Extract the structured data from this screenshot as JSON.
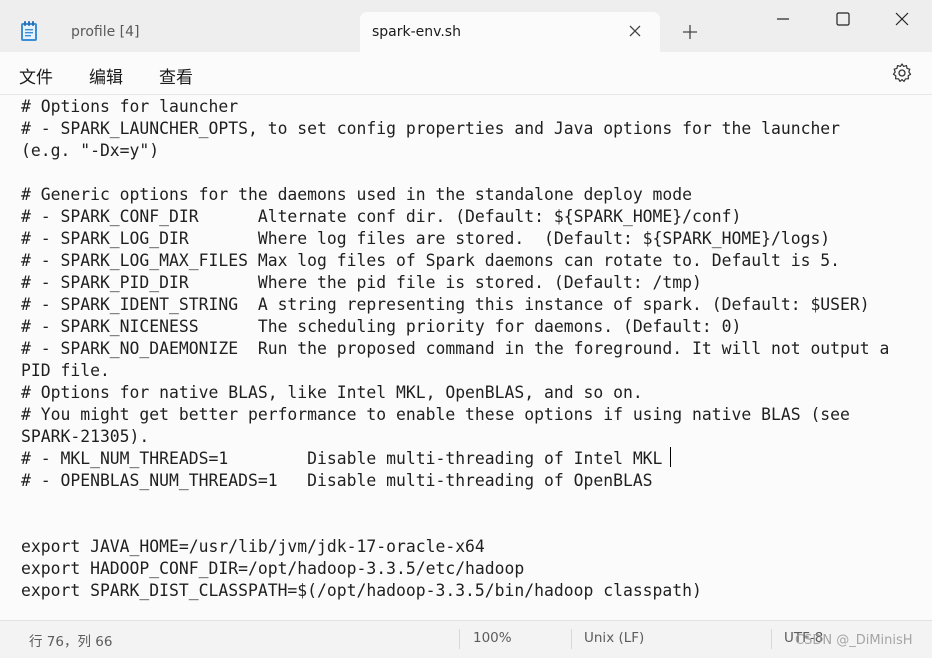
{
  "tabs": [
    {
      "label": "profile [4]",
      "active": false
    },
    {
      "label": "spark-env.sh",
      "active": true
    }
  ],
  "menu": {
    "file": "文件",
    "edit": "编辑",
    "view": "查看"
  },
  "icons": {
    "app": "notepad-icon",
    "close_tab": "close-icon",
    "new_tab": "plus-icon",
    "minimize": "minimize-icon",
    "maximize": "maximize-icon",
    "close_window": "close-window-icon",
    "settings": "gear-icon"
  },
  "editor": {
    "text": "# Options for launcher\n# - SPARK_LAUNCHER_OPTS, to set config properties and Java options for the launcher\n(e.g. \"-Dx=y\")\n\n# Generic options for the daemons used in the standalone deploy mode\n# - SPARK_CONF_DIR      Alternate conf dir. (Default: ${SPARK_HOME}/conf)\n# - SPARK_LOG_DIR       Where log files are stored.  (Default: ${SPARK_HOME}/logs)\n# - SPARK_LOG_MAX_FILES Max log files of Spark daemons can rotate to. Default is 5.\n# - SPARK_PID_DIR       Where the pid file is stored. (Default: /tmp)\n# - SPARK_IDENT_STRING  A string representing this instance of spark. (Default: $USER)\n# - SPARK_NICENESS      The scheduling priority for daemons. (Default: 0)\n# - SPARK_NO_DAEMONIZE  Run the proposed command in the foreground. It will not output a\nPID file.\n# Options for native BLAS, like Intel MKL, OpenBLAS, and so on.\n# You might get better performance to enable these options if using native BLAS (see\nSPARK-21305).\n# - MKL_NUM_THREADS=1        Disable multi-threading of Intel MKL\n# - OPENBLAS_NUM_THREADS=1   Disable multi-threading of OpenBLAS\n\n\nexport JAVA_HOME=/usr/lib/jvm/jdk-17-oracle-x64\nexport HADOOP_CONF_DIR=/opt/hadoop-3.3.5/etc/hadoop\nexport SPARK_DIST_CLASSPATH=$(/opt/hadoop-3.3.5/bin/hadoop classpath)"
  },
  "status": {
    "position": "行 76，列 66",
    "zoom": "100%",
    "line_ending": "Unix (LF)",
    "encoding": "UTF-8"
  },
  "watermark": "CSDN @_DiMinisH"
}
